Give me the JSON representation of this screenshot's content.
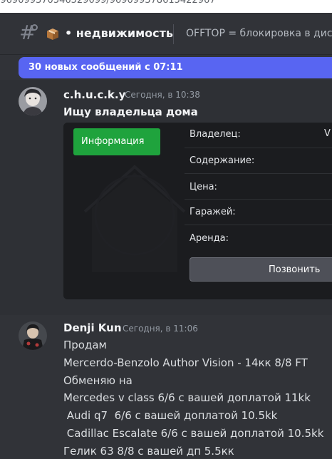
{
  "browser": {
    "url_fragment": "/969099370546529099/969099378615422967"
  },
  "header": {
    "channel_name": "• недвижимость",
    "topic": "OFFTOP = блокировка в диско"
  },
  "banner": {
    "text": "30 новых сообщений с 07:11"
  },
  "messages": [
    {
      "author": "c.h.u.c.k.y",
      "timestamp": "Сегодня, в 10:38",
      "title": "Ищу владельца дома",
      "embed": {
        "info_button": "Информация",
        "owner_value_fragment": "V",
        "fields": [
          "Владелец:",
          "Содержание:",
          "Цена:",
          "Гаражей:",
          "Аренда:"
        ],
        "call_button": "Позвонить"
      }
    },
    {
      "author": "Denji Kun",
      "timestamp": "Сегодня, в 11:06",
      "lines": [
        "Продам",
        "Mercerdo-Benzolo Author Vision - 14кк 8/8 FT",
        "Обменяю на",
        "Mercedes v class 6/6 с вашей доплатой 11kk",
        " Audi q7  6/6 с вашей доплатой 10.5kk",
        " Cadillac Escalate 6/6 с вашей доплатой 10.5kk",
        "Гелик 63 8/8 с вашей дп 5.5кк"
      ]
    }
  ],
  "colors": {
    "banner": "#5865f2",
    "info_button": "#1fa33d",
    "background": "#313338"
  }
}
